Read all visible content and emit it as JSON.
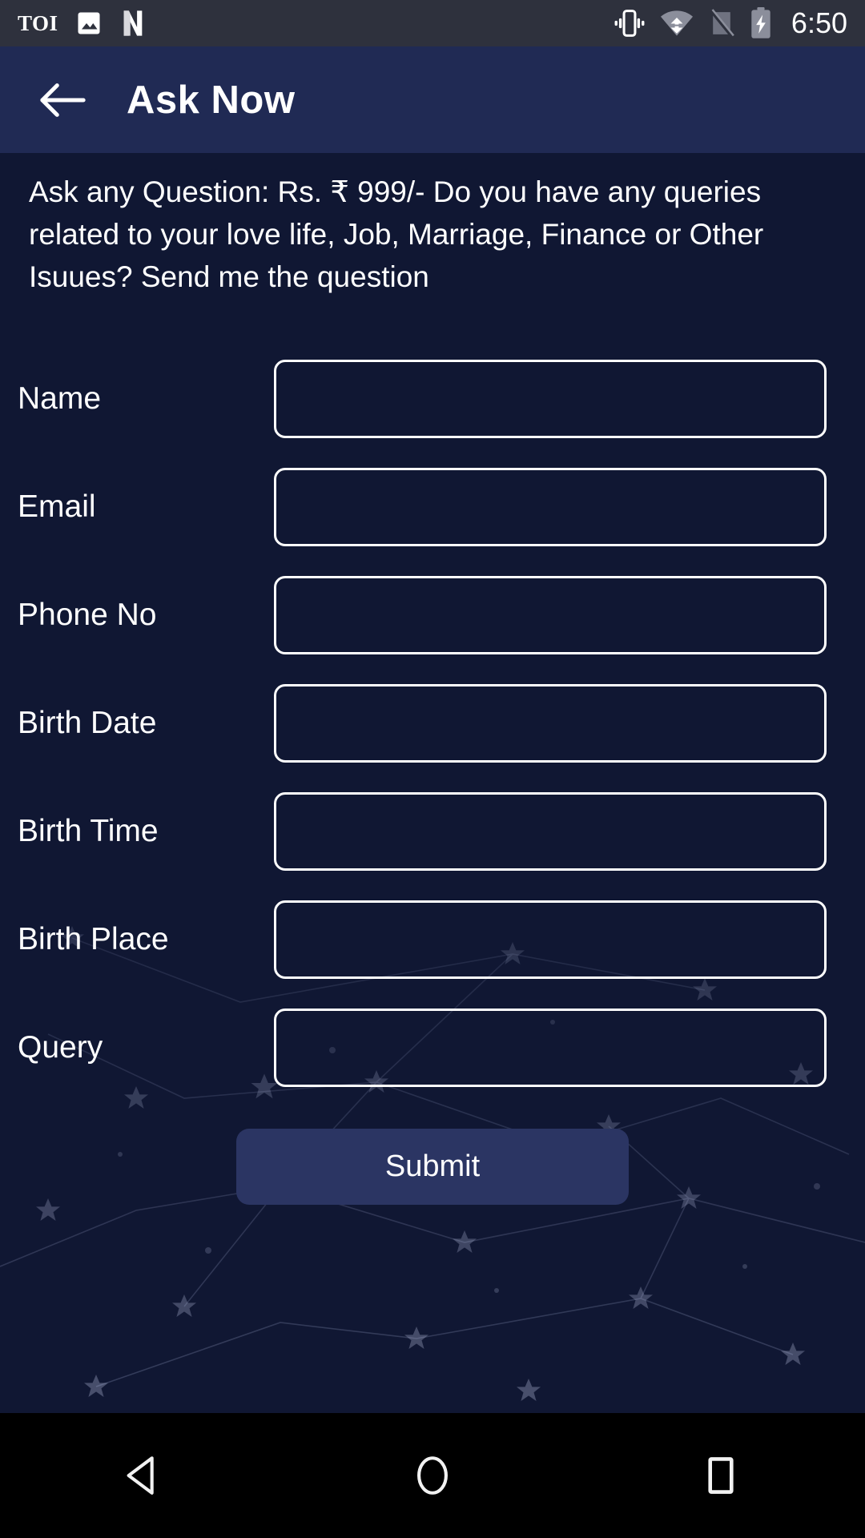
{
  "status_bar": {
    "time": "6:50",
    "left_icons": [
      {
        "name": "toi-logo-icon",
        "label": "TOI"
      },
      {
        "name": "image-icon",
        "label": ""
      },
      {
        "name": "netflix-n-icon",
        "label": ""
      }
    ],
    "right_icons": [
      {
        "name": "vibrate-icon",
        "label": ""
      },
      {
        "name": "wifi-transfer-icon",
        "label": ""
      },
      {
        "name": "no-signal-icon",
        "label": ""
      },
      {
        "name": "battery-charging-icon",
        "label": ""
      }
    ]
  },
  "app_bar": {
    "back_label": "back",
    "title": "Ask Now"
  },
  "main": {
    "description": "Ask any Question: Rs. ₹ 999/- Do you have any queries related to your love life, Job, Marriage, Finance or Other Isuues? Send me the question",
    "fields": [
      {
        "label": "Name",
        "value": "",
        "placeholder": ""
      },
      {
        "label": "Email",
        "value": "",
        "placeholder": ""
      },
      {
        "label": "Phone No",
        "value": "",
        "placeholder": ""
      },
      {
        "label": "Birth Date",
        "value": "",
        "placeholder": ""
      },
      {
        "label": "Birth Time",
        "value": "",
        "placeholder": ""
      },
      {
        "label": "Birth Place",
        "value": "",
        "placeholder": ""
      },
      {
        "label": "Query",
        "value": "",
        "placeholder": ""
      }
    ],
    "submit_label": "Submit"
  },
  "nav_bar": {
    "back_label": "Back",
    "home_label": "Home",
    "recents_label": "Recent apps"
  },
  "colors": {
    "status_bar_bg": "#2e313d",
    "app_bar_bg": "#202a54",
    "page_bg": "#101733",
    "submit_bg": "#2b3563",
    "text": "#ffffff",
    "nav_bar_bg": "#000000"
  }
}
